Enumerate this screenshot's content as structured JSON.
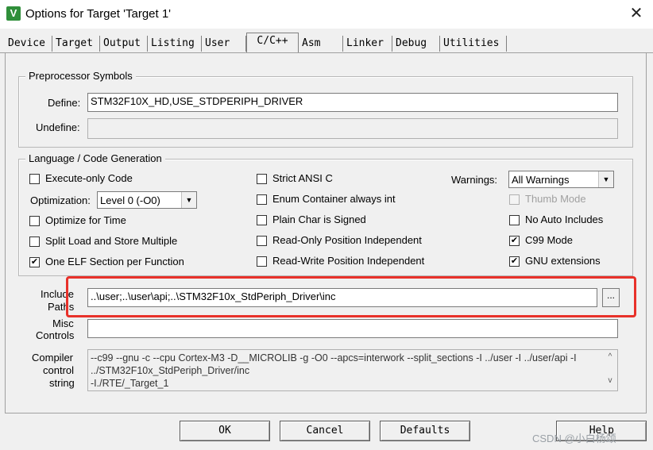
{
  "window": {
    "title": "Options for Target 'Target 1'",
    "icon": "keil-uvision-icon",
    "close_glyph": "✕"
  },
  "tabs": [
    "Device",
    "Target",
    "Output",
    "Listing",
    "User",
    "C/C++",
    "Asm",
    "Linker",
    "Debug",
    "Utilities"
  ],
  "active_tab": "C/C++",
  "preprocessor": {
    "group_title": "Preprocessor Symbols",
    "define_label": "Define:",
    "define_value": "STM32F10X_HD,USE_STDPERIPH_DRIVER",
    "undefine_label": "Undefine:",
    "undefine_value": ""
  },
  "language": {
    "group_title": "Language / Code Generation",
    "execute_only": {
      "label": "Execute-only Code",
      "checked": false
    },
    "optimization_label": "Optimization:",
    "optimization_value": "Level 0 (-O0)",
    "optimize_time": {
      "label": "Optimize for Time",
      "checked": false
    },
    "split_load": {
      "label": "Split Load and Store Multiple",
      "checked": false
    },
    "one_elf": {
      "label": "One ELF Section per Function",
      "checked": true
    },
    "strict_ansi": {
      "label": "Strict ANSI C",
      "checked": false
    },
    "enum_container": {
      "label": "Enum Container always int",
      "checked": false
    },
    "plain_char": {
      "label": "Plain Char is Signed",
      "checked": false
    },
    "ro_pi": {
      "label": "Read-Only Position Independent",
      "checked": false
    },
    "rw_pi": {
      "label": "Read-Write Position Independent",
      "checked": false
    },
    "warnings_label": "Warnings:",
    "warnings_value": "All Warnings",
    "thumb_mode": {
      "label": "Thumb Mode",
      "checked": false,
      "disabled": true
    },
    "no_auto_includes": {
      "label": "No Auto Includes",
      "checked": false
    },
    "c99_mode": {
      "label": "C99 Mode",
      "checked": true
    },
    "gnu_extensions": {
      "label": "GNU extensions",
      "checked": true
    }
  },
  "include": {
    "label_line1": "Include",
    "label_line2": "Paths",
    "value": "..\\user;..\\user\\api;..\\STM32F10x_StdPeriph_Driver\\inc",
    "browse_label": "..."
  },
  "misc": {
    "label_line1": "Misc",
    "label_line2": "Controls",
    "value": ""
  },
  "compiler": {
    "label_line1": "Compiler",
    "label_line2": "control",
    "label_line3": "string",
    "line1": "--c99 --gnu -c --cpu Cortex-M3 -D__MICROLIB -g -O0 --apcs=interwork --split_sections -I ../user -I ../user/api -I",
    "line2": "../STM32F10x_StdPeriph_Driver/inc",
    "line3": "-I./RTE/_Target_1",
    "scroll_up": "^",
    "scroll_down": "v"
  },
  "buttons": {
    "ok": "OK",
    "cancel": "Cancel",
    "defaults": "Defaults",
    "help": "Help"
  },
  "watermark": "CSDN @小白杨颂",
  "colors": {
    "highlight_box": "#e8312a",
    "dialog_bg": "#f0f0f0"
  }
}
